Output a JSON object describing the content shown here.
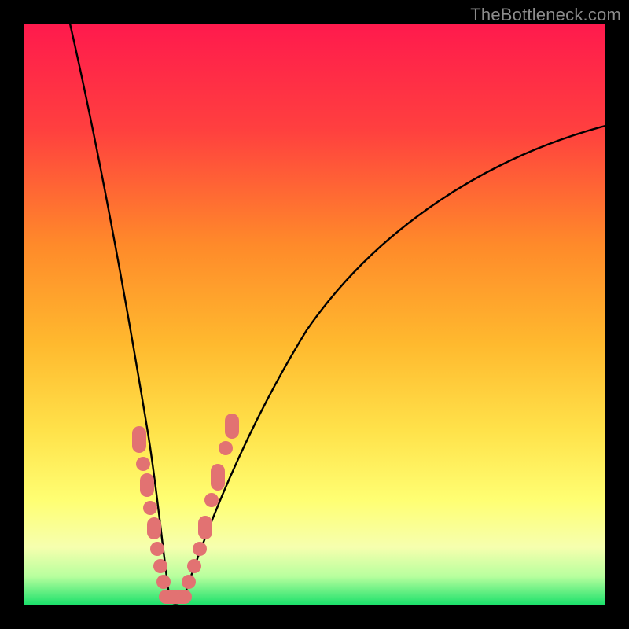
{
  "watermark": "TheBottleneck.com",
  "chart_data": {
    "type": "line",
    "title": "",
    "xlabel": "",
    "ylabel": "",
    "xlim": [
      0,
      100
    ],
    "ylim": [
      0,
      100
    ],
    "grid": false,
    "background_gradient": {
      "top": "#ff1a4d",
      "mid_upper": "#ff8a2a",
      "mid": "#ffd333",
      "mid_lower": "#ffff66",
      "lower_band": "#f8ffb0",
      "bottom": "#18e06a"
    },
    "series": [
      {
        "name": "left-curve",
        "x": [
          8,
          10,
          12,
          14,
          16,
          18,
          19,
          20,
          21,
          22,
          23,
          24
        ],
        "y": [
          100,
          80,
          62,
          47,
          35,
          25,
          20,
          16,
          12,
          8,
          4,
          0
        ]
      },
      {
        "name": "right-curve",
        "x": [
          27,
          30,
          34,
          38,
          44,
          52,
          62,
          74,
          88,
          100
        ],
        "y": [
          0,
          7,
          15,
          23,
          33,
          44,
          55,
          66,
          76,
          82
        ]
      }
    ],
    "scatter_clusters": [
      {
        "name": "left-arm-dots",
        "points": [
          {
            "x": 18.5,
            "y": 28
          },
          {
            "x": 19.0,
            "y": 25
          },
          {
            "x": 19.8,
            "y": 21
          },
          {
            "x": 20.2,
            "y": 18
          },
          {
            "x": 20.8,
            "y": 15
          },
          {
            "x": 21.2,
            "y": 12
          },
          {
            "x": 21.8,
            "y": 9
          },
          {
            "x": 22.4,
            "y": 6
          },
          {
            "x": 23.0,
            "y": 3
          }
        ]
      },
      {
        "name": "right-arm-dots",
        "points": [
          {
            "x": 28.5,
            "y": 3
          },
          {
            "x": 29.5,
            "y": 6
          },
          {
            "x": 30.5,
            "y": 9
          },
          {
            "x": 31.5,
            "y": 12
          },
          {
            "x": 32.5,
            "y": 15
          },
          {
            "x": 33.8,
            "y": 19
          },
          {
            "x": 35.0,
            "y": 23
          },
          {
            "x": 36.0,
            "y": 26
          },
          {
            "x": 37.0,
            "y": 29
          }
        ]
      },
      {
        "name": "valley-dots",
        "points": [
          {
            "x": 24.0,
            "y": 1
          },
          {
            "x": 25.5,
            "y": 0.5
          },
          {
            "x": 27.0,
            "y": 1
          }
        ]
      }
    ],
    "notes": "V-shaped bottleneck curve on red→green vertical gradient; axes unlabeled; minimum near x≈25; salmon dot clusters along both arms and valley."
  },
  "colors": {
    "dot": "#e27272",
    "curve": "#000000",
    "frame": "#000000",
    "watermark": "#8c8c8c"
  }
}
